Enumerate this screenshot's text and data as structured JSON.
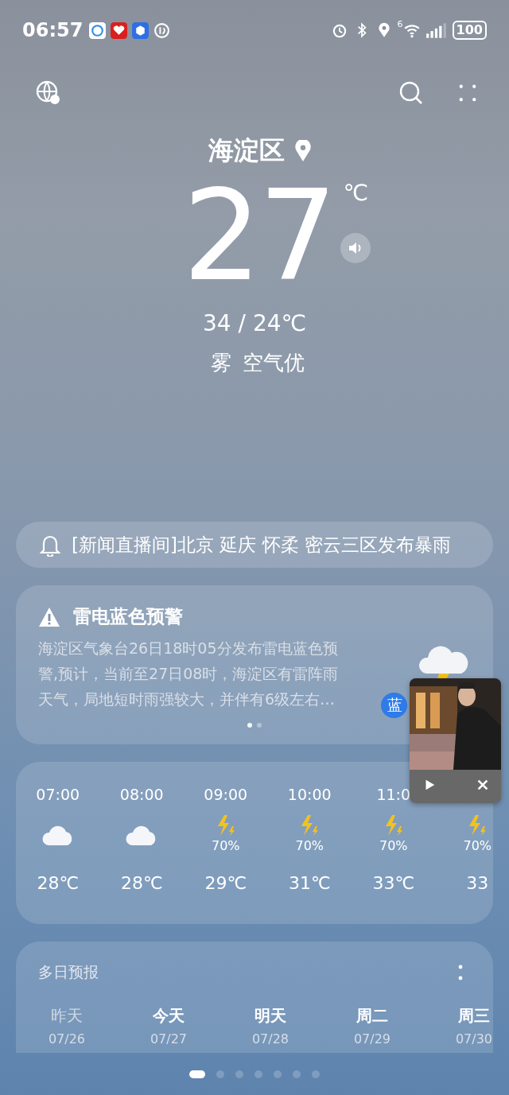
{
  "status_bar": {
    "time": "06:57",
    "network": "6",
    "battery": "100"
  },
  "location": "海淀区",
  "temperature": "27",
  "unit": "℃",
  "range": "34 / 24℃",
  "condition": "雾",
  "air": "空气优",
  "news": "[新闻直播间]北京 延庆 怀柔 密云三区发布暴雨",
  "alert": {
    "title": "雷电蓝色预警",
    "body": "海淀区气象台26日18时05分发布雷电蓝色预警,预计，当前至27日08时，海淀区有雷阵雨天气，局地短时雨强较大，并伴有6级左右…",
    "badge": "蓝",
    "dots": [
      {
        "selected": true
      },
      {
        "selected": false
      }
    ]
  },
  "hourly": [
    {
      "time": "07:00",
      "kind": "cloudy",
      "temp": "28℃"
    },
    {
      "time": "08:00",
      "kind": "cloudy",
      "temp": "28℃"
    },
    {
      "time": "09:00",
      "kind": "thunder",
      "chance": "70%",
      "temp": "29℃"
    },
    {
      "time": "10:00",
      "kind": "thunder",
      "chance": "70%",
      "temp": "31℃"
    },
    {
      "time": "11:0",
      "kind": "thunder",
      "chance": "70%",
      "temp": "33℃"
    },
    {
      "kind": "thunder",
      "chance": "70%",
      "temp": "33"
    }
  ],
  "forecast": {
    "title": "多日预报",
    "days": [
      {
        "label": "昨天",
        "date": "07/26",
        "past": true
      },
      {
        "label": "今天",
        "date": "07/27",
        "past": false
      },
      {
        "label": "明天",
        "date": "07/28",
        "past": false
      },
      {
        "label": "周二",
        "date": "07/29",
        "past": false
      },
      {
        "label": "周三",
        "date": "07/30",
        "past": false
      }
    ]
  },
  "pages": [
    {
      "selected": true
    },
    {
      "selected": false
    },
    {
      "selected": false
    },
    {
      "selected": false
    },
    {
      "selected": false
    },
    {
      "selected": false
    },
    {
      "selected": false
    }
  ]
}
